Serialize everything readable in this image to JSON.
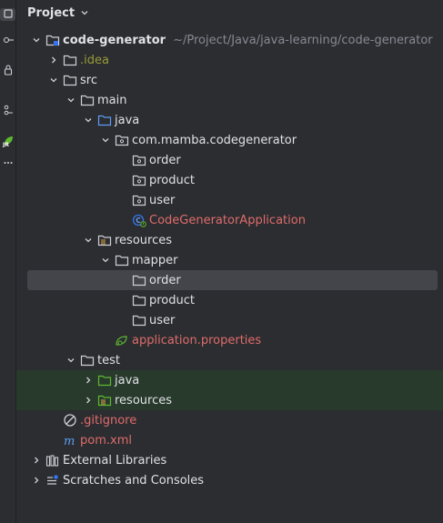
{
  "panel": {
    "title": "Project"
  },
  "tree": {
    "root": {
      "label": "code-generator",
      "path": "~/Project/Java/java-learning/code-generator"
    },
    "idea": ".idea",
    "src": "src",
    "main": "main",
    "java": "java",
    "package": "com.mamba.codegenerator",
    "pkg_order": "order",
    "pkg_product": "product",
    "pkg_user": "user",
    "app_class": "CodeGeneratorApplication",
    "resources": "resources",
    "mapper": "mapper",
    "mapper_order": "order",
    "mapper_product": "product",
    "mapper_user": "user",
    "app_props": "application.properties",
    "test": "test",
    "test_java": "java",
    "test_resources": "resources",
    "gitignore": ".gitignore",
    "pom": "pom.xml",
    "external": "External Libraries",
    "scratches": "Scratches and Consoles"
  },
  "colors": {
    "accent_blue": "#3574f0",
    "file_red": "#e06c6c",
    "excluded_olive": "#9a9a3a",
    "selection": "#43454a",
    "test_green_bg": "#283a2c"
  }
}
